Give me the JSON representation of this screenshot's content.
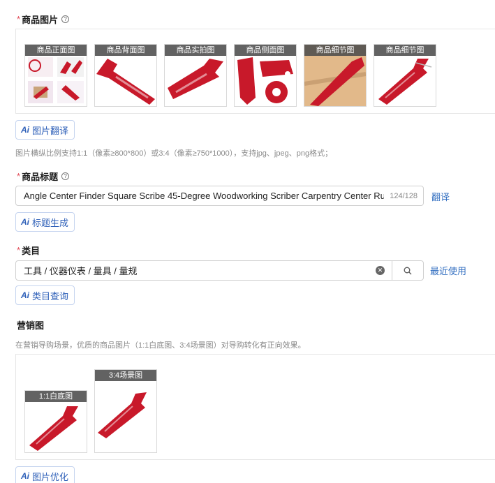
{
  "images_section": {
    "label": "商品图片",
    "thumbs": [
      {
        "caption": "商品正面图"
      },
      {
        "caption": "商品背面图"
      },
      {
        "caption": "商品实拍图"
      },
      {
        "caption": "商品侧面图"
      },
      {
        "caption": "商品细节图"
      },
      {
        "caption": "商品细节图"
      }
    ],
    "ai_button": "图片翻译",
    "hint": "图片横纵比例支持1:1（像素≥800*800）或3:4（像素≥750*1000），支持jpg、jpeg、png格式；"
  },
  "title_section": {
    "label": "商品标题",
    "value": "Angle Center Finder Square Scribe 45-Degree Woodworking Scriber Carpentry Center Ruler",
    "counter": "124/128",
    "translate_link": "翻译",
    "ai_button": "标题生成"
  },
  "category_section": {
    "label": "类目",
    "value": "工具 / 仪器仪表 / 量具 / 量规",
    "recent_link": "最近使用",
    "ai_button": "类目查询"
  },
  "marketing_section": {
    "label": "营销图",
    "hint": "在营销导购场景，优质的商品图片（1:1白底图、3:4场景图）对导购转化有正向效果。",
    "thumbs": [
      {
        "caption": "1:1白底图"
      },
      {
        "caption": "3:4场景图"
      }
    ],
    "ai_button": "图片优化"
  },
  "colors": {
    "product_red": "#c8192a",
    "accent_blue": "#2d5fb8",
    "required_red": "#e34d59"
  }
}
